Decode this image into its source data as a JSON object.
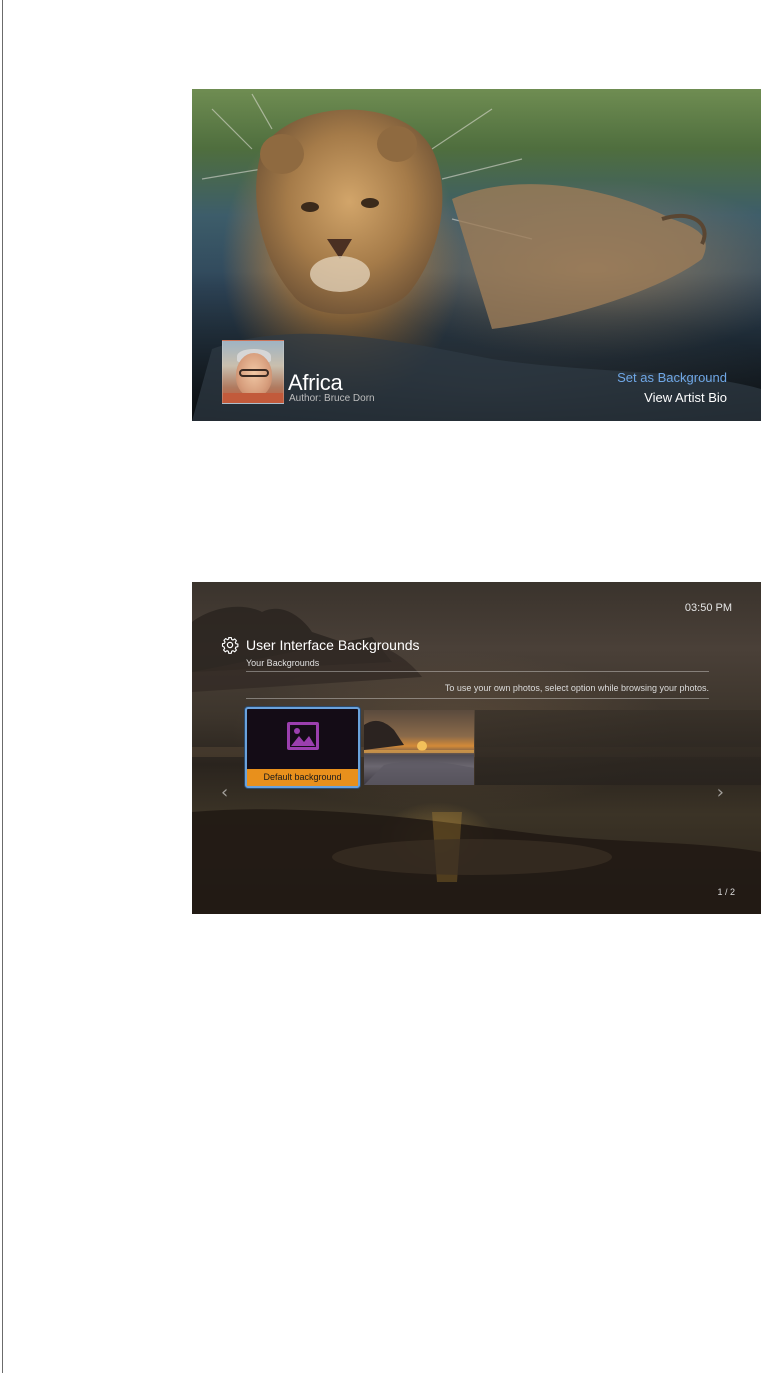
{
  "screen1": {
    "album_title": "Africa",
    "author": "Author: Bruce Dorn",
    "options": {
      "set_background": "Set as Background",
      "view_artist_bio": "View Artist Bio"
    },
    "highlight_color": "#6fa7e6",
    "artist_photo_icon": "artist-portrait"
  },
  "screen2": {
    "clock": "03:50 PM",
    "title": "User Interface Backgrounds",
    "section_label": "Your Backgrounds",
    "hint": "To use your own photos, select option while browsing your photos.",
    "default_label": "Default background",
    "default_icon": "image-icon",
    "page_indicator": "1 / 2",
    "left_arrow": "‹",
    "right_arrow": "›",
    "selection_color": "#6aa2dc",
    "label_bg_color": "#e8901c",
    "icon_color": "#9b3fae"
  }
}
